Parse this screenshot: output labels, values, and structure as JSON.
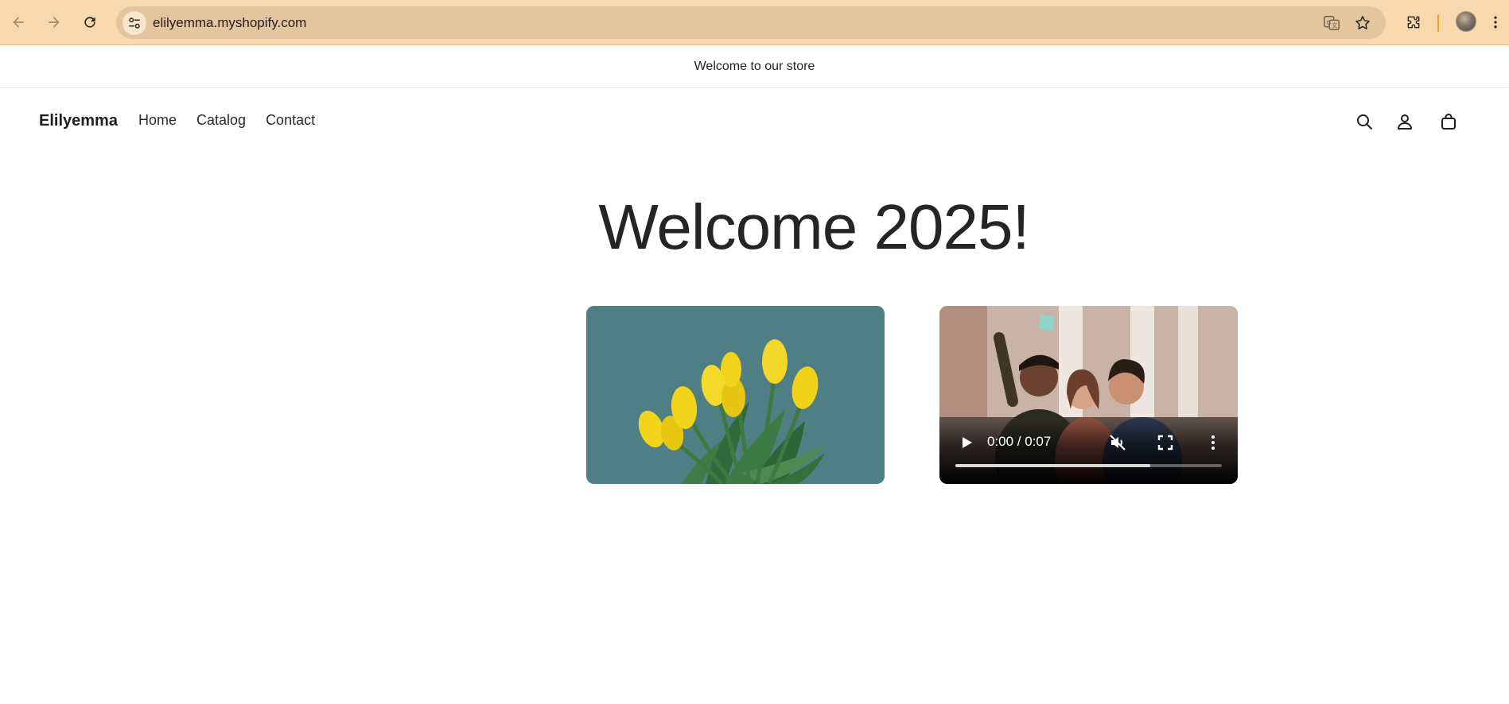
{
  "browser": {
    "url": "elilyemma.myshopify.com",
    "back_icon": "back-arrow-icon",
    "forward_icon": "forward-arrow-icon",
    "reload_icon": "reload-icon",
    "site_settings_icon": "tune-icon",
    "translate_icon": "translate-icon",
    "bookmark_icon": "star-icon",
    "extensions_icon": "puzzle-icon",
    "profile_icon": "avatar",
    "menu_icon": "kebab-menu-icon"
  },
  "announcement": {
    "text": "Welcome to our store"
  },
  "header": {
    "brand": "Elilyemma",
    "nav": [
      {
        "label": "Home"
      },
      {
        "label": "Catalog"
      },
      {
        "label": "Contact"
      }
    ],
    "icons": [
      "search-icon",
      "account-icon",
      "cart-icon"
    ]
  },
  "main": {
    "title": "Welcome 2025!",
    "image_card": {
      "description_icon": "tulips-image"
    },
    "video_card": {
      "time": "0:00 / 0:07",
      "progress": 0.73,
      "controls": [
        "play-icon",
        "muted-icon",
        "fullscreen-icon",
        "more-options-icon"
      ]
    }
  },
  "colors": {
    "chrome_bg": "#f8d8ad",
    "omnibox_bg": "#e3c59e",
    "accent_divider": "#f0a51f",
    "text": "#222222",
    "tulip_bg": "#4f7f84",
    "tulip_yellow": "#f2d51b"
  }
}
